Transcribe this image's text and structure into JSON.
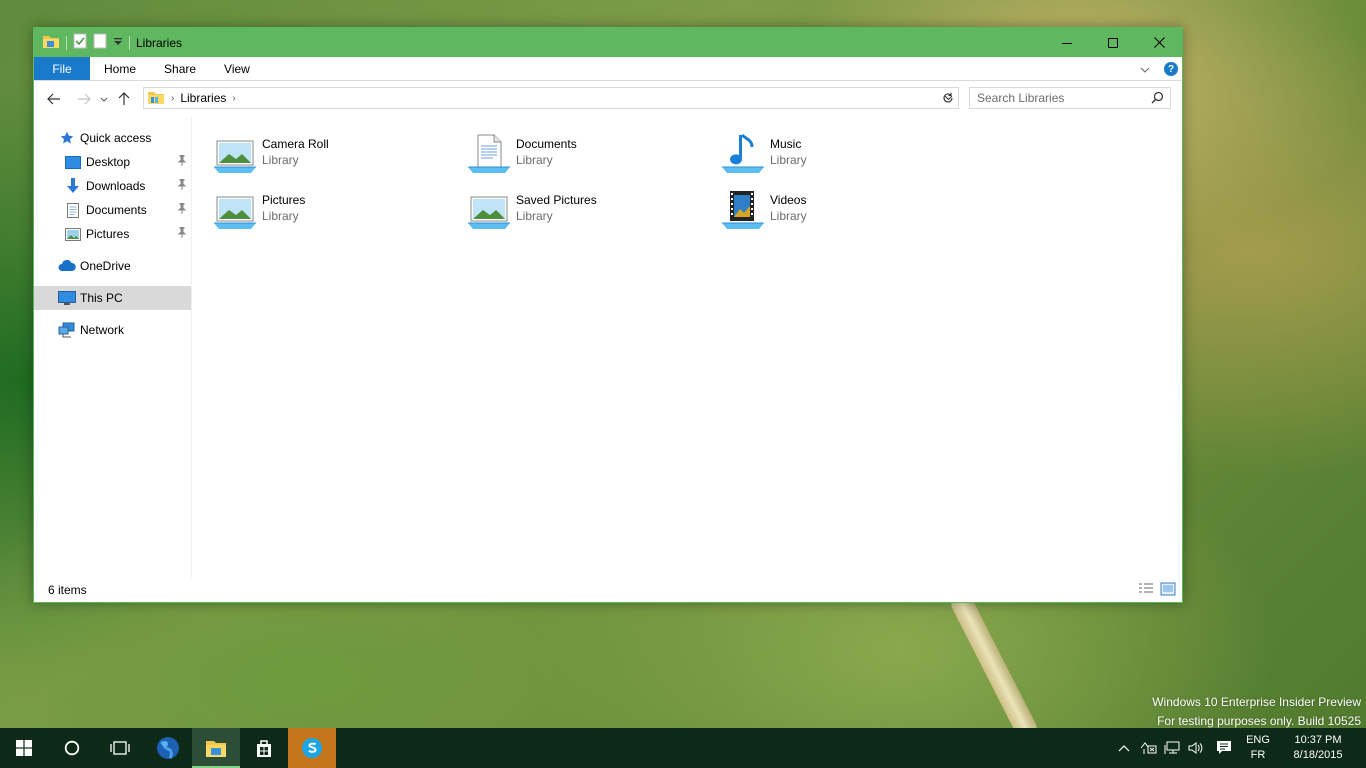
{
  "window": {
    "title": "Libraries",
    "tabs": {
      "file": "File",
      "home": "Home",
      "share": "Share",
      "view": "View"
    },
    "help_label": "?",
    "address": {
      "crumb": "Libraries"
    },
    "search": {
      "placeholder": "Search Libraries"
    }
  },
  "nav": {
    "quick_access": "Quick access",
    "desktop": "Desktop",
    "downloads": "Downloads",
    "documents": "Documents",
    "pictures": "Pictures",
    "onedrive": "OneDrive",
    "this_pc": "This PC",
    "network": "Network"
  },
  "libraries": [
    {
      "name": "Camera Roll",
      "type": "Library"
    },
    {
      "name": "Documents",
      "type": "Library"
    },
    {
      "name": "Music",
      "type": "Library"
    },
    {
      "name": "Pictures",
      "type": "Library"
    },
    {
      "name": "Saved Pictures",
      "type": "Library"
    },
    {
      "name": "Videos",
      "type": "Library"
    }
  ],
  "status": {
    "items": "6 items"
  },
  "watermark": {
    "line1": "Windows 10 Enterprise Insider Preview",
    "line2": "For testing purposes only. Build 10525"
  },
  "taskbar": {
    "lang_top": "ENG",
    "lang_bottom": "FR",
    "time": "10:37 PM",
    "date": "8/18/2015"
  },
  "colors": {
    "title_bar": "#5fb760",
    "file_tab": "#1979ca",
    "taskbar": "#0c2a17",
    "skype": "#c5761a"
  }
}
